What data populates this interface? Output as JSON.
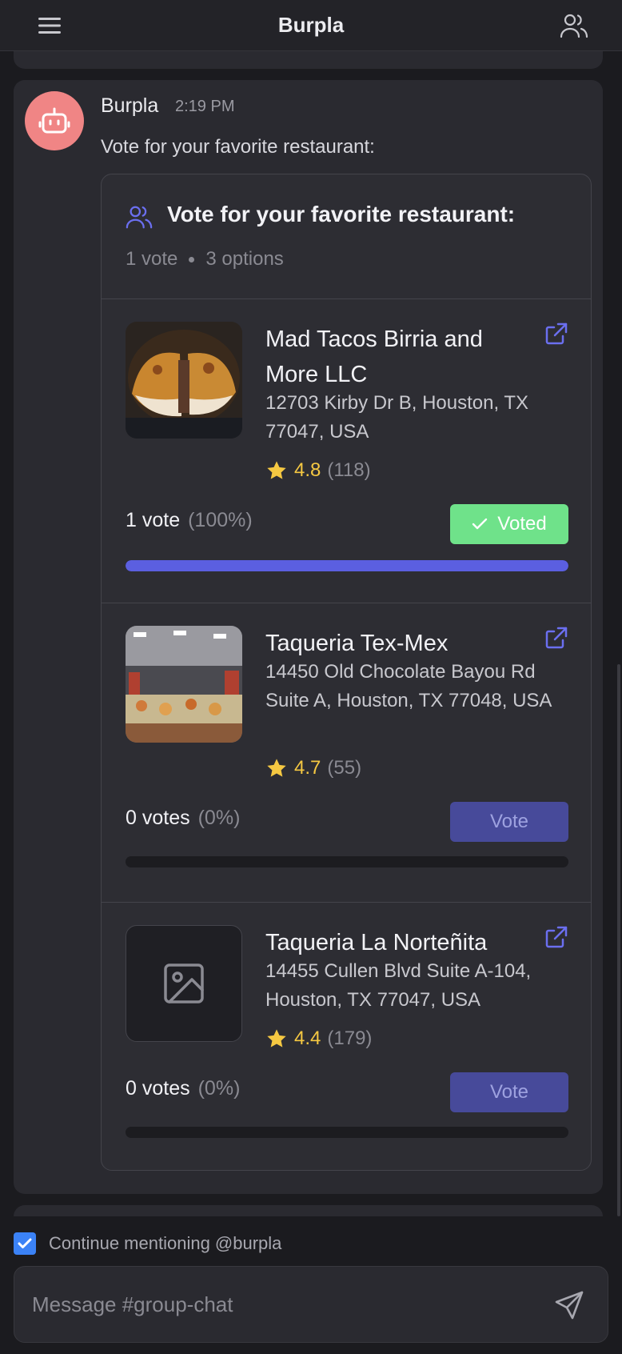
{
  "header": {
    "title": "Burpla",
    "menu_icon": "hamburger-menu-icon",
    "members_icon": "users-icon"
  },
  "message": {
    "sender": "Burpla",
    "time": "2:19 PM",
    "text": "Vote for your favorite restaurant:",
    "avatar_icon": "robot-icon",
    "avatar_color": "#f08585"
  },
  "poll": {
    "title": "Vote for your favorite restaurant:",
    "meta_votes": "1 vote",
    "meta_options": "3 options",
    "accent_color": "#5b5fe0",
    "options": [
      {
        "name": "Mad Tacos Birria and More LLC",
        "address": "12703 Kirby Dr B, Houston, TX 77047, USA",
        "rating": "4.8",
        "review_count": "(118)",
        "votes_label": "1 vote",
        "percent_label": "(100%)",
        "fill_fraction": 1.0,
        "button_label": "Voted",
        "voted": true
      },
      {
        "name": "Taqueria Tex-Mex",
        "address": "14450 Old Chocolate Bayou Rd Suite A, Houston, TX 77048, USA",
        "rating": "4.7",
        "review_count": "(55)",
        "votes_label": "0 votes",
        "percent_label": "(0%)",
        "fill_fraction": 0,
        "button_label": "Vote",
        "voted": false
      },
      {
        "name": "Taqueria La Norteñita",
        "address": "14455 Cullen Blvd Suite A-104, Houston, TX 77047, USA",
        "rating": "4.4",
        "review_count": "(179)",
        "votes_label": "0 votes",
        "percent_label": "(0%)",
        "fill_fraction": 0,
        "button_label": "Vote",
        "voted": false
      }
    ]
  },
  "footer": {
    "mention_label": "Continue mentioning @burpla",
    "mention_checked": true,
    "composer_placeholder": "Message #group-chat",
    "send_icon": "send-icon"
  }
}
